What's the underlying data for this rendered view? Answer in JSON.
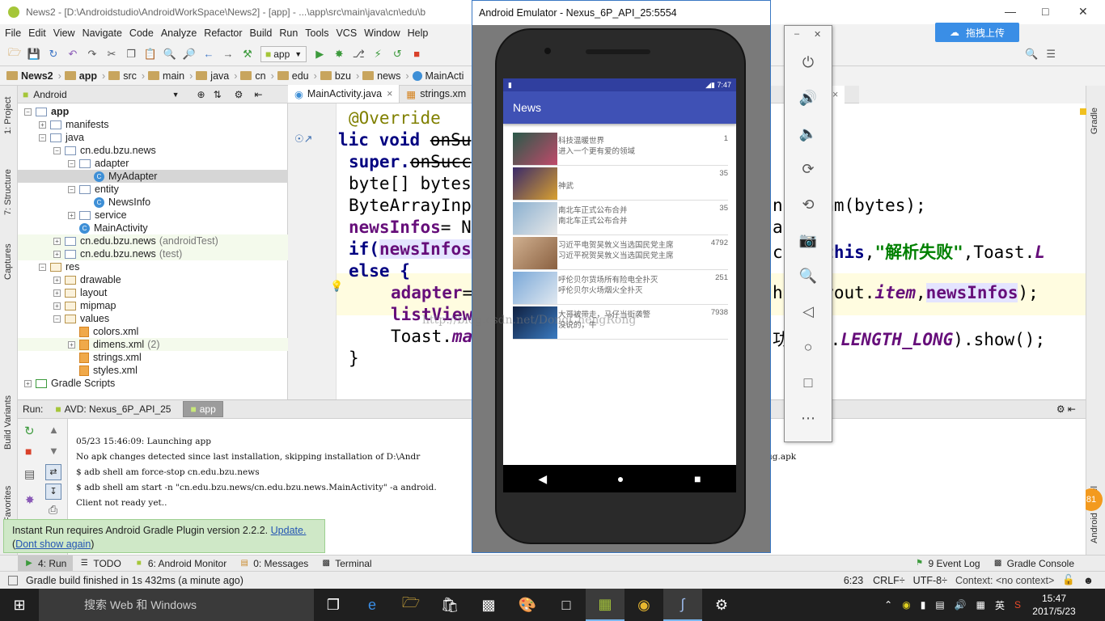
{
  "ide": {
    "title": "News2 - [D:\\Androidstudio\\AndroidWorkSpace\\News2] - [app] - ...\\app\\src\\main\\java\\cn\\edu\\b",
    "menu": [
      "File",
      "Edit",
      "View",
      "Navigate",
      "Code",
      "Analyze",
      "Refactor",
      "Build",
      "Run",
      "Tools",
      "VCS",
      "Window",
      "Help"
    ],
    "run_config": "app",
    "upload_button": "拖拽上传",
    "breadcrumb": [
      "News2",
      "app",
      "src",
      "main",
      "java",
      "cn",
      "edu",
      "bzu",
      "news",
      "MainActi"
    ],
    "left_strip": [
      "1: Project",
      "7: Structure",
      "Captures",
      "Build Variants",
      "Favorites"
    ],
    "right_strip": [
      "Gradle",
      "Android Model"
    ],
    "project_view": "Android",
    "tree": [
      {
        "label": "app",
        "level": 0,
        "kind": "folder-bold",
        "expanded": true
      },
      {
        "label": "manifests",
        "level": 1,
        "kind": "folder",
        "expanded": false
      },
      {
        "label": "java",
        "level": 1,
        "kind": "folder",
        "expanded": true
      },
      {
        "label": "cn.edu.bzu.news",
        "level": 2,
        "kind": "folder",
        "expanded": true
      },
      {
        "label": "adapter",
        "level": 3,
        "kind": "folder",
        "expanded": true
      },
      {
        "label": "MyAdapter",
        "level": 4,
        "kind": "class",
        "selected": true
      },
      {
        "label": "entity",
        "level": 3,
        "kind": "folder",
        "expanded": true
      },
      {
        "label": "NewsInfo",
        "level": 4,
        "kind": "class"
      },
      {
        "label": "service",
        "level": 3,
        "kind": "folder",
        "expanded": false
      },
      {
        "label": "MainActivity",
        "level": 3,
        "kind": "class"
      },
      {
        "label": "cn.edu.bzu.news",
        "level": 2,
        "kind": "folder",
        "suffix": "(androidTest)",
        "expanded": false
      },
      {
        "label": "cn.edu.bzu.news",
        "level": 2,
        "kind": "folder",
        "suffix": "(test)",
        "expanded": false
      },
      {
        "label": "res",
        "level": 1,
        "kind": "res",
        "expanded": true
      },
      {
        "label": "drawable",
        "level": 2,
        "kind": "res",
        "expanded": false
      },
      {
        "label": "layout",
        "level": 2,
        "kind": "res",
        "expanded": false
      },
      {
        "label": "mipmap",
        "level": 2,
        "kind": "res",
        "expanded": false
      },
      {
        "label": "values",
        "level": 2,
        "kind": "res",
        "expanded": true
      },
      {
        "label": "colors.xml",
        "level": 3,
        "kind": "xml"
      },
      {
        "label": "dimens.xml",
        "level": 3,
        "kind": "xml",
        "suffix": "(2)",
        "expanded": false
      },
      {
        "label": "strings.xml",
        "level": 3,
        "kind": "xml"
      },
      {
        "label": "styles.xml",
        "level": 3,
        "kind": "xml"
      },
      {
        "label": "Gradle Scripts",
        "level": 0,
        "kind": "gradle",
        "expanded": false
      }
    ],
    "editor_tabs": [
      "MainActivity.java",
      "strings.xm"
    ],
    "editor_tab_right": "a",
    "code": {
      "l1": "@Override",
      "l2a": "lic void ",
      "l2b": "onSu",
      "l3a": "super.",
      "l3b": "onSucc",
      "l4": "byte[] bytes",
      "l5": "ByteArrayInp",
      "l6a": "newsInfos",
      "l6b": "= N",
      "l7a": "if(",
      "l7b": "newsInfos",
      "l8": "else {",
      "l9a": "adapter",
      "l9b": "=",
      "l10": "listView",
      "l11a": "Toast.",
      "l11b": "ma",
      "l12": "}",
      "r5": "np   ream(bytes);",
      "r6": "at",
      "r7a": "ct   y.",
      "r7b": "this",
      "r7c": ",",
      "r7d": "\"解析失败\"",
      "r7e": ",Toast.",
      "r7f": "L",
      "r9a": "ht   layout.",
      "r9b": "item",
      "r9c": ",",
      "r9d": "newsInfos",
      "r9e": ");",
      "r11a": "功   ast.",
      "r11b": "LENGTH_LONG",
      "r11c": ").show();"
    },
    "run_label": "Run:",
    "run_tabs": [
      "AVD: Nexus_6P_API_25",
      "app"
    ],
    "console": [
      "05/23 15:46:09: Launching app",
      "No apk changes detected since last installation, skipping installation of D:\\Andr",
      "$ adb shell am force-stop cn.edu.bzu.news",
      "$ adb shell am start -n \"cn.edu.bzu.news/cn.edu.bzu.news.MainActivity\" -a android.",
      "Client not ready yet.."
    ],
    "console_tail": "ug.apk",
    "notice": {
      "text": "Instant Run requires Android Gradle Plugin version 2.2.2. ",
      "update": "Update.",
      "open_paren": "(",
      "dont_show": "Dont show again",
      "close_paren": ")"
    },
    "tool_tabs": [
      "4: Run",
      "TODO",
      "6: Android Monitor",
      "0: Messages",
      "Terminal"
    ],
    "tool_tabs_right": [
      "9 Event Log",
      "Gradle Console"
    ],
    "status": {
      "message": "Gradle build finished in 1s 432ms (a minute ago)",
      "position": "6:23",
      "line_sep": "CRLF÷",
      "encoding": "UTF-8÷",
      "context": "Context: <no context>"
    },
    "badge": "81"
  },
  "emulator": {
    "title": "Android Emulator - Nexus_6P_API_25:5554",
    "time": "7:47",
    "app_title": "News",
    "news": [
      {
        "title": "科技温暖世界",
        "desc": "进入一个更有爱的领域",
        "count": "1",
        "img": [
          "#2a5a4a",
          "#c04a6a"
        ]
      },
      {
        "title": "",
        "desc": "神武",
        "count": "35",
        "img": [
          "#3a2a6a",
          "#d8a030"
        ]
      },
      {
        "title": "南北车正式公布合并",
        "desc": "南北车正式公布合并",
        "count": "35",
        "img": [
          "#8ab0d0",
          "#e8e8e8"
        ]
      },
      {
        "title": "习近平电贺吴敦义当选国民党主席",
        "desc": "习近平祝贺吴敦义当选国民党主席",
        "count": "4792",
        "img": [
          "#d0b090",
          "#8a6040"
        ]
      },
      {
        "title": "呼伦贝尔货场所有险电全扑灭",
        "desc": "呼伦贝尔火场烟火全扑灭",
        "count": "251",
        "img": [
          "#7aa8d8",
          "#e0e8f0"
        ]
      },
      {
        "title": "大哥被带走，马仔当街袭警",
        "desc": "没说的，牛",
        "count": "7938",
        "img": [
          "#102040",
          "#3a7ac0"
        ]
      }
    ],
    "watermark": "http://blog.csdn.net/DongChengRong"
  },
  "taskbar": {
    "search": "搜索 Web 和 Windows",
    "ime": "英",
    "time": "15:47",
    "date": "2017/5/23"
  },
  "colors": {
    "appbar": "#3f51b5",
    "statusbar": "#303f9f",
    "notice": "#cfe8c7",
    "emu_border": "#3a78c3"
  }
}
